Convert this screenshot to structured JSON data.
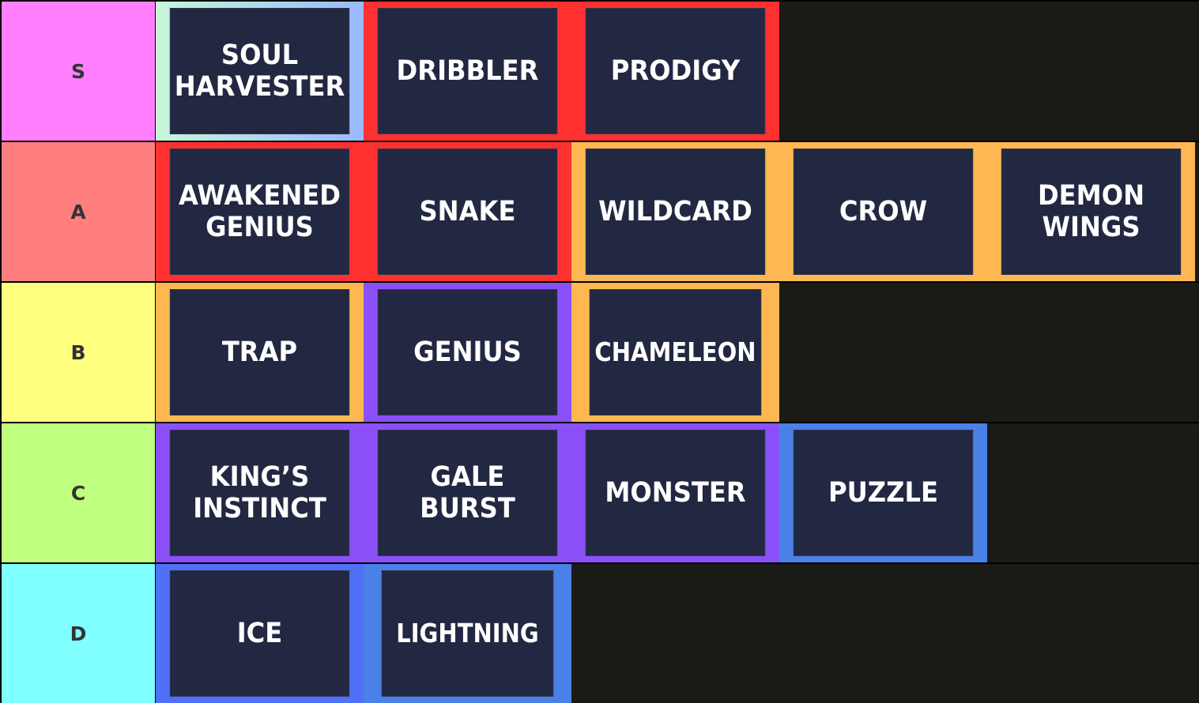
{
  "tiers": [
    {
      "label": "S",
      "color": "#ff7fff",
      "items": [
        {
          "name": "SOUL\nHARVESTER",
          "border": "linear-gradient(90deg,#c8f7d8,#9ab8ff)"
        },
        {
          "name": "DRIBBLER",
          "border": "#ff3030"
        },
        {
          "name": "PRODIGY",
          "border": "#ff3030"
        }
      ]
    },
    {
      "label": "A",
      "color": "#ff7f7f",
      "items": [
        {
          "name": "AWAKENED\nGENIUS",
          "border": "#ff3030"
        },
        {
          "name": "SNAKE",
          "border": "#ff3030"
        },
        {
          "name": "WILDCARD",
          "border": "#ffb851"
        },
        {
          "name": "CROW",
          "border": "#ffb851"
        },
        {
          "name": "DEMON\nWINGS",
          "border": "#ffb851"
        }
      ]
    },
    {
      "label": "B",
      "color": "#ffff7f",
      "items": [
        {
          "name": "TRAP",
          "border": "#ffb851"
        },
        {
          "name": "GENIUS",
          "border": "#8b50f8"
        },
        {
          "name": "CHAMELEON",
          "border": "#ffb851"
        }
      ]
    },
    {
      "label": "C",
      "color": "#bfff7f",
      "items": [
        {
          "name": "KING’S\nINSTINCT",
          "border": "#8b50f8"
        },
        {
          "name": "GALE\nBURST",
          "border": "#8b50f8"
        },
        {
          "name": "MONSTER",
          "border": "#8b50f8"
        },
        {
          "name": "PUZZLE",
          "border": "#4a80e8"
        }
      ]
    },
    {
      "label": "D",
      "color": "#7fffff",
      "items": [
        {
          "name": "ICE",
          "border": "#5070f8"
        },
        {
          "name": "LIGHTNING",
          "border": "#4a80e8"
        }
      ]
    }
  ]
}
